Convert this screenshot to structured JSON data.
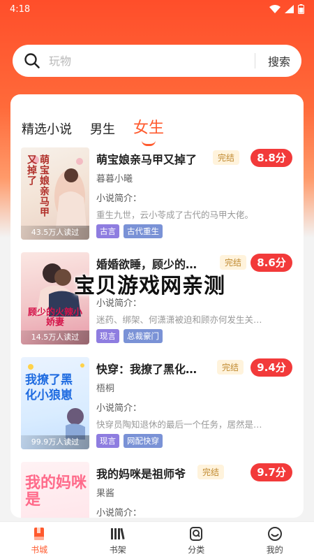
{
  "status_bar": {
    "time": "4:18"
  },
  "search": {
    "placeholder": "玩物",
    "button_label": "搜索"
  },
  "tabs": [
    {
      "label": "精选小说",
      "active": false
    },
    {
      "label": "男生",
      "active": false
    },
    {
      "label": "女生",
      "active": true
    }
  ],
  "books": [
    {
      "title": "萌宝娘亲马甲又掉了",
      "status": "完结",
      "score": "8.8分",
      "author": "暮暮小曦",
      "intro_label": "小说简介：",
      "intro": "重生九世，云小苓成了古代的马甲大佬。",
      "tags": [
        "古言",
        "古代重生"
      ],
      "readers": "43.5万人读过",
      "cover_title": "萌宝娘亲马甲又掉了"
    },
    {
      "title": "婚婚欲睡，顾少的…",
      "status": "完结",
      "score": "8.6分",
      "author": "",
      "intro_label": "小说简介：",
      "intro": "迷药、绑架、何潇潇被迫和顾亦何发生关…",
      "tags": [
        "现言",
        "总裁豪门"
      ],
      "readers": "14.5万人读过",
      "cover_title": "顾少的火辣小娇妻"
    },
    {
      "title": "快穿：我撩了黑化…",
      "status": "完结",
      "score": "9.4分",
      "author": "梧桐",
      "intro_label": "小说简介：",
      "intro": "快穿员陶知退休的最后一个任务，居然是…",
      "tags": [
        "现言",
        "网配快穿"
      ],
      "readers": "99.9万人读过",
      "cover_title": "我撩了黑化小狼崽"
    },
    {
      "title": "我的妈咪是祖师爷",
      "status": "完结",
      "score": "9.7分",
      "author": "果酱",
      "intro_label": "小说简介：",
      "intro": "",
      "tags": [],
      "readers": "",
      "cover_title": "我的妈咪是"
    }
  ],
  "watermark": "宝贝游戏网亲测",
  "bottom_nav": [
    {
      "label": "书城",
      "icon": "book-icon",
      "active": true
    },
    {
      "label": "书架",
      "icon": "bookshelf-icon",
      "active": false
    },
    {
      "label": "分类",
      "icon": "category-icon",
      "active": false
    },
    {
      "label": "我的",
      "icon": "profile-icon",
      "active": false
    }
  ],
  "colors": {
    "accent": "#ff5a2e",
    "score_badge": "#f23a3a",
    "tag_purple": "#8e7de0"
  }
}
